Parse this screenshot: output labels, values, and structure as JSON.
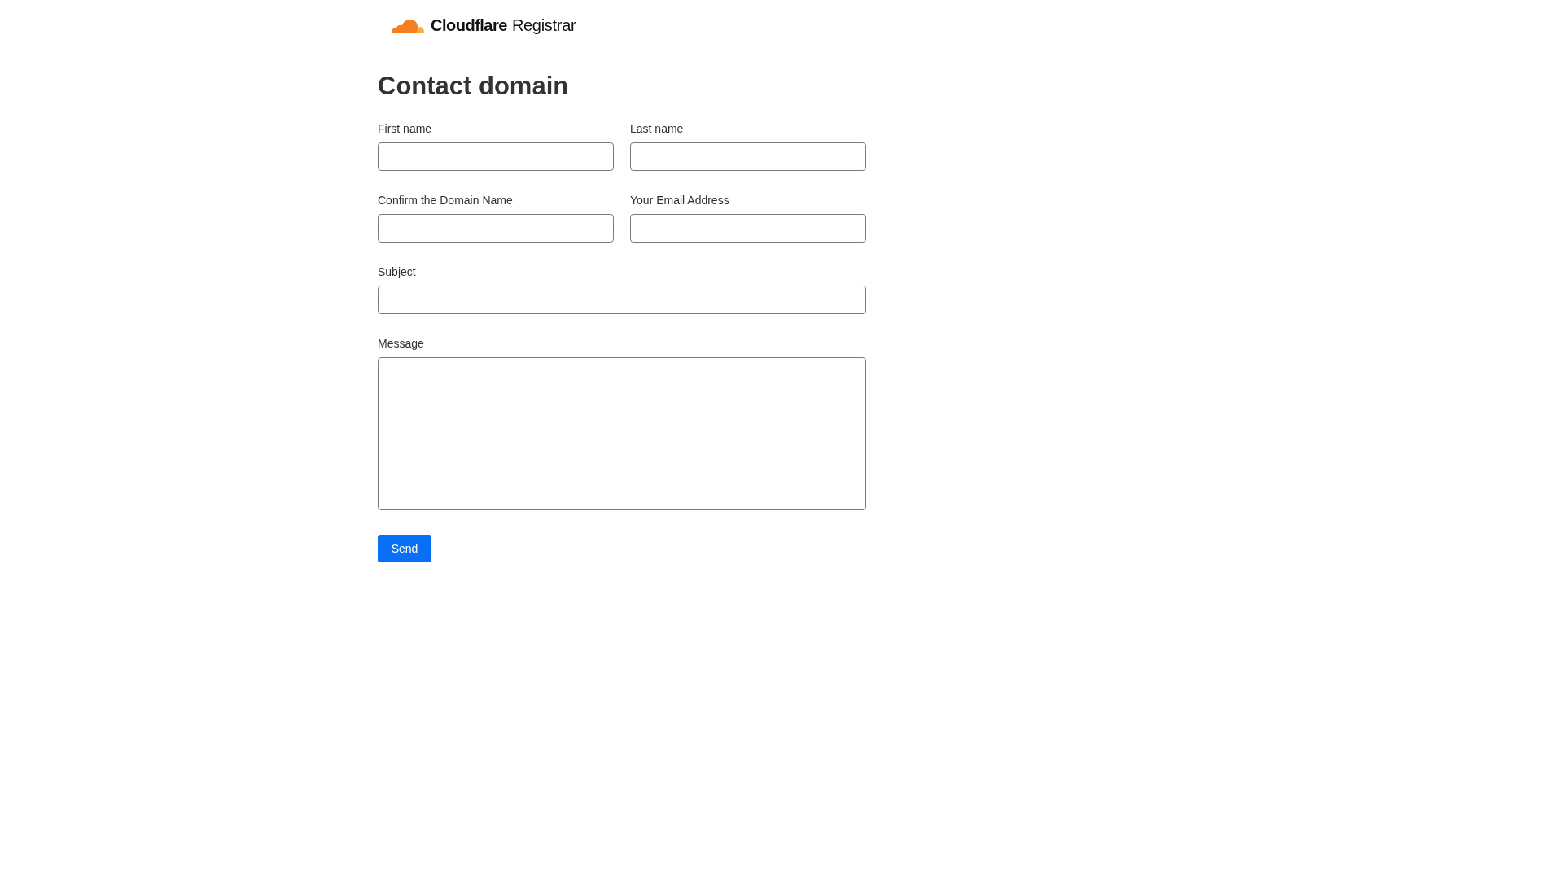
{
  "header": {
    "brand": "Cloudflare",
    "product": "Registrar"
  },
  "title": "Contact domain",
  "fields": [
    {
      "kind": "short",
      "label": "First name"
    },
    {
      "kind": "short",
      "label": "Last name"
    },
    {
      "kind": "short",
      "label": "Confirm the Domain Name"
    },
    {
      "kind": "short",
      "label": "Your Email Address"
    },
    {
      "kind": "wide",
      "label": "Subject"
    },
    {
      "kind": "textarea",
      "label": "Message"
    }
  ],
  "submit": "Send"
}
